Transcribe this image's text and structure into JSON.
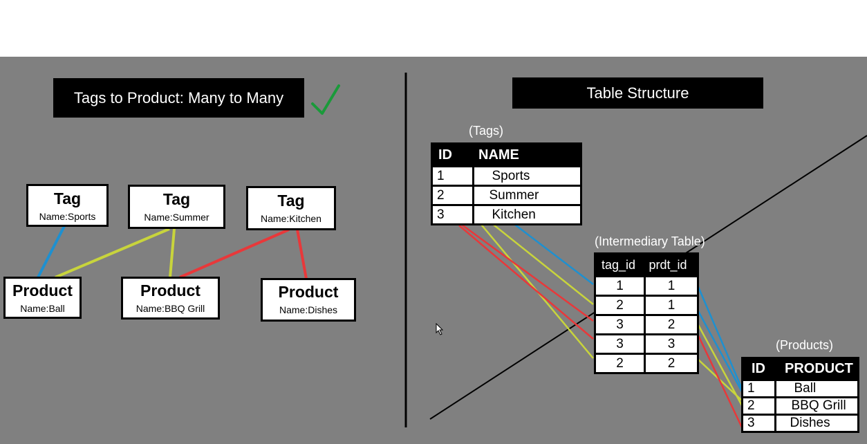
{
  "left": {
    "title": "Tags to Product: Many to Many",
    "tags": [
      {
        "head": "Tag",
        "sub": "Name:Sports"
      },
      {
        "head": "Tag",
        "sub": "Name:Summer"
      },
      {
        "head": "Tag",
        "sub": "Name:Kitchen"
      }
    ],
    "products": [
      {
        "head": "Product",
        "sub": "Name:Ball"
      },
      {
        "head": "Product",
        "sub": "Name:BBQ Grill"
      },
      {
        "head": "Product",
        "sub": "Name:Dishes"
      }
    ]
  },
  "right": {
    "title": "Table Structure",
    "tags_caption": "(Tags)",
    "tags_table": {
      "headers": [
        "ID",
        "NAME"
      ],
      "rows": [
        [
          "1",
          "Sports"
        ],
        [
          "2",
          "Summer"
        ],
        [
          "3",
          "Kitchen"
        ]
      ]
    },
    "intermediary_caption": "(Intermediary Table)",
    "intermediary_table": {
      "headers": [
        "tag_id",
        "prdt_id"
      ],
      "rows": [
        [
          "1",
          "1"
        ],
        [
          "2",
          "1"
        ],
        [
          "3",
          "2"
        ],
        [
          "3",
          "3"
        ],
        [
          "2",
          "2"
        ]
      ]
    },
    "products_caption": "(Products)",
    "products_table": {
      "headers": [
        "ID",
        "PRODUCT"
      ],
      "rows": [
        [
          "1",
          "Ball"
        ],
        [
          "2",
          "BBQ Grill"
        ],
        [
          "3",
          "Dishes"
        ]
      ]
    }
  },
  "colors": {
    "background": "#808080",
    "sports_link": "#1e90d0",
    "summer_link": "#c8d43c",
    "kitchen_link": "#e8383a",
    "check": "#1a9a3a"
  },
  "icons": [
    "checkmark-icon",
    "cursor-icon"
  ]
}
